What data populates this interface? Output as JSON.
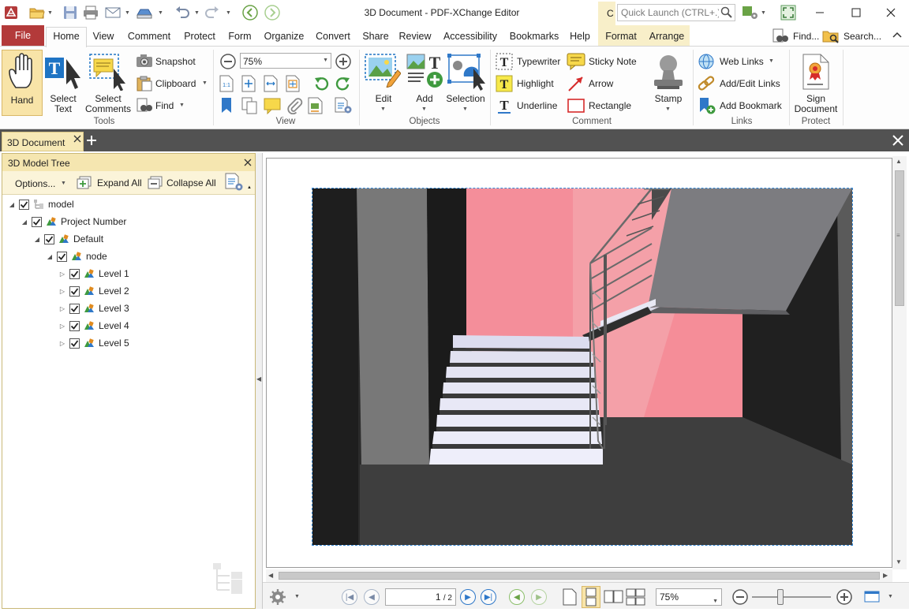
{
  "title_bar": {
    "title": "3D Document - PDF-XChange Editor",
    "quick_launch_placeholder": "Quick Launch (CTRL+.)",
    "ctx_letter": "C"
  },
  "menu_tabs": {
    "file": "File",
    "home": "Home",
    "view": "View",
    "comment": "Comment",
    "protect": "Protect",
    "form": "Form",
    "organize": "Organize",
    "convert": "Convert",
    "share": "Share",
    "review": "Review",
    "accessibility": "Accessibility",
    "bookmarks": "Bookmarks",
    "help": "Help",
    "format": "Format",
    "arrange": "Arrange",
    "find": "Find...",
    "search": "Search..."
  },
  "ribbon": {
    "tools": {
      "group_label": "Tools",
      "hand": "Hand",
      "select_text": "Select\nText",
      "select_text_1": "Select",
      "select_text_2": "Text",
      "select_comments_1": "Select",
      "select_comments_2": "Comments",
      "snapshot": "Snapshot",
      "clipboard": "Clipboard",
      "find": "Find"
    },
    "view": {
      "group_label": "View",
      "zoom_value": "75%"
    },
    "objects": {
      "group_label": "Objects",
      "edit": "Edit",
      "add": "Add",
      "selection": "Selection"
    },
    "comment": {
      "group_label": "Comment",
      "typewriter": "Typewriter",
      "sticky_note": "Sticky Note",
      "highlight": "Highlight",
      "arrow": "Arrow",
      "underline": "Underline",
      "rectangle": "Rectangle",
      "stamp": "Stamp"
    },
    "links": {
      "group_label": "Links",
      "web_links": "Web Links",
      "add_edit_links": "Add/Edit Links",
      "add_bookmark": "Add Bookmark"
    },
    "protect": {
      "group_label": "Protect",
      "sign_1": "Sign",
      "sign_2": "Document"
    }
  },
  "doc_tab": {
    "label": "3D Document"
  },
  "left_pane": {
    "title": "3D Model Tree",
    "options": "Options...",
    "expand_all": "Expand All",
    "collapse_all": "Collapse All",
    "tree": [
      {
        "label": "model",
        "level": 0
      },
      {
        "label": "Project Number",
        "level": 1
      },
      {
        "label": "Default",
        "level": 2
      },
      {
        "label": "node",
        "level": 3
      },
      {
        "label": "Level 1",
        "level": 4
      },
      {
        "label": "Level 2",
        "level": 4
      },
      {
        "label": "Level 3",
        "level": 4
      },
      {
        "label": "Level 4",
        "level": 4
      },
      {
        "label": "Level 5",
        "level": 4
      }
    ]
  },
  "bottom_bar": {
    "page_value": "1",
    "page_total": "/ 2",
    "zoom_value": "75%"
  },
  "colors": {
    "file_tab": "#b33a3a",
    "pane_header": "#f5e6b0",
    "doc_tab": "#f7e9b6",
    "dark_bar": "#525252",
    "selection_border": "#3a8bd8",
    "wall_pink": "#f08a94"
  }
}
